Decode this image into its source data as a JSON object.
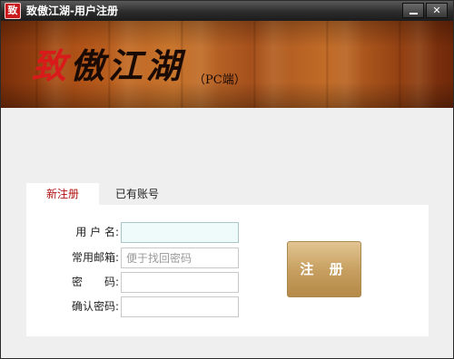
{
  "window": {
    "icon_char": "致",
    "title": "致傲江湖-用户注册",
    "controls": {
      "minimize": "minimize",
      "close": "✕"
    }
  },
  "banner": {
    "logo_first": "致",
    "logo_rest": "傲江湖",
    "logo_sub": "（PC端）"
  },
  "tabs": [
    {
      "label": "新注册",
      "active": true
    },
    {
      "label": "已有账号",
      "active": false
    }
  ],
  "form": {
    "username_label": "用 户 名:",
    "username_value": "",
    "email_label": "常用邮箱:",
    "email_placeholder": "便于找回密码",
    "password_label": "密　　码:",
    "confirm_label": "确认密码:",
    "submit_label": "注 册"
  },
  "colors": {
    "title_bar": "#2c2c2c",
    "active_tab_text": "#b01010",
    "logo_red": "#d81a1a",
    "button_gold": "#c59d5e"
  }
}
